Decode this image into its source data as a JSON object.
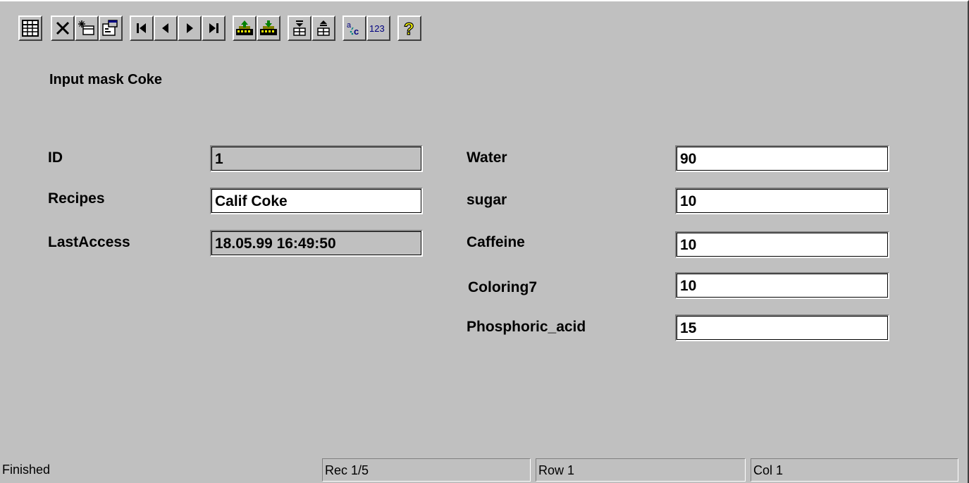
{
  "toolbar": {
    "buttons": [
      {
        "icon": "table-view-icon"
      },
      {
        "icon": "delete-icon"
      },
      {
        "icon": "new-record-icon"
      },
      {
        "icon": "properties-icon"
      },
      {
        "icon": "first-record-icon"
      },
      {
        "icon": "previous-record-icon"
      },
      {
        "icon": "next-record-icon"
      },
      {
        "icon": "last-record-icon"
      },
      {
        "icon": "export-icon"
      },
      {
        "icon": "import-icon"
      },
      {
        "icon": "move-down-icon"
      },
      {
        "icon": "move-up-icon"
      },
      {
        "icon": "text-mode-icon",
        "text": "a c"
      },
      {
        "icon": "numeric-mode-icon",
        "text": "123"
      },
      {
        "icon": "help-icon",
        "text": "?"
      }
    ]
  },
  "form": {
    "title": "Input mask Coke",
    "left_fields": [
      {
        "label": "ID",
        "value": "1",
        "editable": false
      },
      {
        "label": "Recipes",
        "value": "Calif Coke",
        "editable": true
      },
      {
        "label": "LastAccess",
        "value": "18.05.99 16:49:50",
        "editable": false
      }
    ],
    "right_fields": [
      {
        "label": "Water",
        "value": "90"
      },
      {
        "label": "sugar",
        "value": "10"
      },
      {
        "label": "Caffeine",
        "value": "10"
      },
      {
        "label": "Coloring7",
        "value": "10"
      },
      {
        "label": "Phosphoric_acid",
        "value": "15"
      }
    ]
  },
  "status": {
    "message": "Finished",
    "record": "Rec 1/5",
    "row": "Row 1",
    "col": "Col 1"
  },
  "colors": {
    "face": "#c0c0c0",
    "highlight": "#ffffff",
    "shadow": "#808080",
    "help_yellow": "#ffff00"
  }
}
